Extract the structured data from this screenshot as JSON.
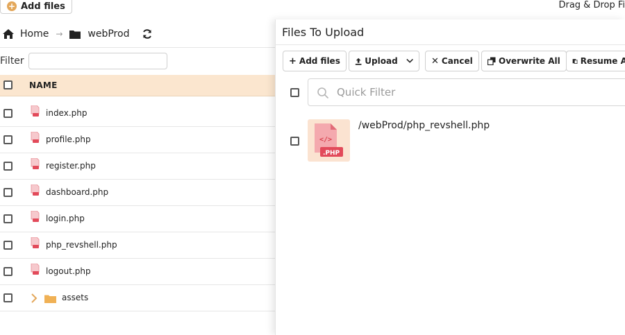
{
  "topbar": {
    "add_files_label": "Add files",
    "drag_drop_label": "Drag & Drop Fi"
  },
  "breadcrumb": {
    "home": "Home",
    "folder": "webProd"
  },
  "filter": {
    "label": "Filter",
    "value": ""
  },
  "table": {
    "name_header": "NAME",
    "files": [
      {
        "name": "index.php"
      },
      {
        "name": "profile.php"
      },
      {
        "name": "register.php"
      },
      {
        "name": "dashboard.php"
      },
      {
        "name": "login.php"
      },
      {
        "name": "php_revshell.php"
      },
      {
        "name": "logout.php"
      }
    ],
    "folders": [
      {
        "name": "assets"
      }
    ]
  },
  "upload_panel": {
    "title": "Files To Upload",
    "buttons": {
      "add_files": "Add files",
      "upload": "Upload",
      "cancel": "Cancel",
      "overwrite_all": "Overwrite All",
      "resume_all": "Resume Al"
    },
    "quick_filter_placeholder": "Quick Filter",
    "items": [
      {
        "path": "/webProd/php_revshell.php",
        "badge": ".PHP"
      }
    ]
  },
  "colors": {
    "header_bg": "#fbe6cf",
    "accent": "#e3a75a",
    "php_red": "#e24a5a"
  }
}
